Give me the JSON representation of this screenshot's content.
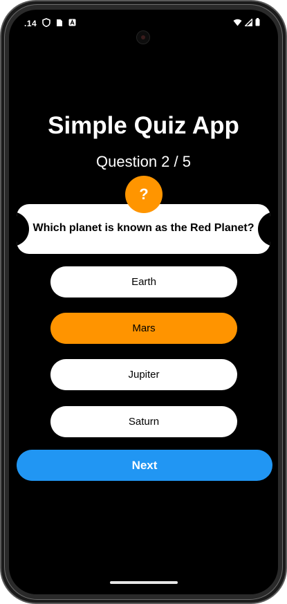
{
  "status_bar": {
    "time": ".14",
    "left_icons": [
      "shield-icon",
      "sim-card-icon",
      "app-notification-icon"
    ],
    "right_icons": [
      "wifi-icon",
      "cell-signal-icon",
      "battery-icon"
    ]
  },
  "app": {
    "title": "Simple Quiz App",
    "question_counter": "Question 2 / 5",
    "badge_symbol": "?",
    "question": "Which planet is known as the Red Planet?",
    "options": [
      {
        "label": "Earth",
        "selected": false
      },
      {
        "label": "Mars",
        "selected": true
      },
      {
        "label": "Jupiter",
        "selected": false
      },
      {
        "label": "Saturn",
        "selected": false
      }
    ],
    "next_label": "Next"
  },
  "colors": {
    "background": "#000000",
    "accent_orange": "#ff9500",
    "next_blue": "#2196f3",
    "card_white": "#ffffff"
  }
}
